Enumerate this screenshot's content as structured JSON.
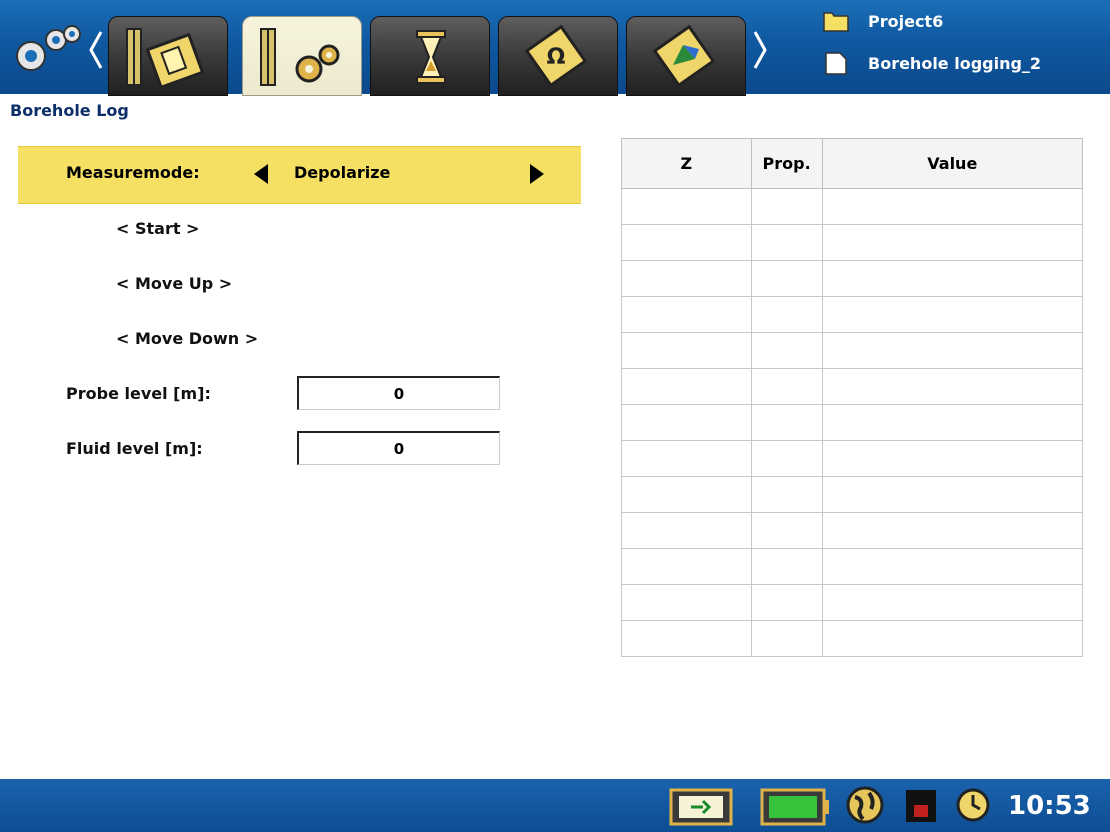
{
  "header": {
    "project_name": "Project6",
    "file_name": "Borehole logging_2",
    "tabs": [
      {
        "name": "borehole-setup",
        "active": false
      },
      {
        "name": "borehole-settings",
        "active": true
      },
      {
        "name": "timer",
        "active": false
      },
      {
        "name": "process",
        "active": false
      },
      {
        "name": "map-view",
        "active": false
      }
    ]
  },
  "page": {
    "title": "Borehole Log"
  },
  "controls": {
    "measuremode_label": "Measuremode:",
    "measuremode_value": "Depolarize",
    "start_label": "< Start >",
    "move_up_label": "< Move Up >",
    "move_down_label": "< Move Down >",
    "probe_level_label": "Probe level [m]:",
    "probe_level_value": "0",
    "fluid_level_label": "Fluid level [m]:",
    "fluid_level_value": "0"
  },
  "table": {
    "columns": [
      "Z",
      "Prop.",
      "Value"
    ],
    "empty_rows": 13
  },
  "status": {
    "time": "10:53",
    "battery_color": "#36c23a"
  },
  "colors": {
    "accent_yellow": "#f6e064",
    "bar_blue": "#0f58a0",
    "title_blue": "#0c2f6a"
  }
}
